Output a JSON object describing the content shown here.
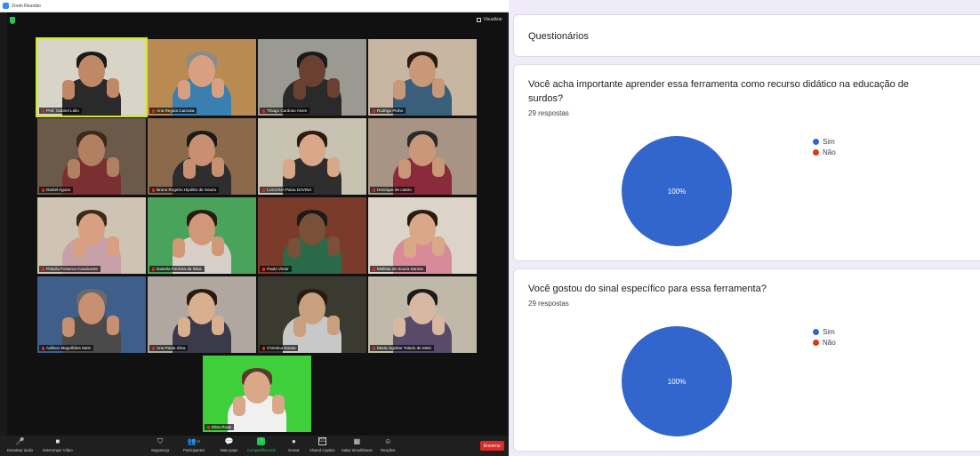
{
  "zoom": {
    "window_title": "Zoom Reunião",
    "view_label": "Visualizar",
    "participants": [
      {
        "name": "Prof. Gabriel Lúlio",
        "active": true
      },
      {
        "name": "Ana Regina Carcosa",
        "active": false
      },
      {
        "name": "Thiago Cardoso Alves",
        "active": false
      },
      {
        "name": "Rodrigo Pinho",
        "active": false
      },
      {
        "name": "Daniel Aguiar",
        "active": false
      },
      {
        "name": "Bruno Rogério Hipólito de Souza",
        "active": false
      },
      {
        "name": "LUCIANA Paiva DAVINA",
        "active": false
      },
      {
        "name": "Henrique de castro",
        "active": false
      },
      {
        "name": "Priscila Fonseca Cavalcante",
        "active": false
      },
      {
        "name": "Daniela Ferreira da Silva",
        "active": false
      },
      {
        "name": "Paulo Victor",
        "active": false
      },
      {
        "name": "Melissa de Souza Santos",
        "active": false
      },
      {
        "name": "Adilson Magalhães Melo",
        "active": false
      },
      {
        "name": "Ana Paula Silva",
        "active": false
      },
      {
        "name": "Christina Sousa",
        "active": false
      },
      {
        "name": "Maria Ogoline Toledo de Melo",
        "active": false
      },
      {
        "name": "Elisa Ruas",
        "active": false
      }
    ],
    "toolbar": {
      "audio": "Desativar áudio",
      "video": "Interromper Vídeo",
      "security": "Segurança",
      "participants": "Participantes",
      "participants_count": "17",
      "chat": "Bate-papo",
      "share": "Compartilhar tela",
      "record": "Gravar",
      "captions": "Closed Caption",
      "breakout": "Salas Simultâneas",
      "reactions": "Reações",
      "leave": "Encerrar"
    }
  },
  "forms": {
    "title": "Questionários",
    "questions": [
      {
        "text": "Você acha importante aprender essa ferramenta como recurso didático na educação de surdos?",
        "responses": "29 respostas"
      },
      {
        "text": "Você gostou do sinal específico para essa ferramenta?",
        "responses": "29 respostas"
      }
    ]
  },
  "chart_data": [
    {
      "type": "pie",
      "categories": [
        "Sim",
        "Não"
      ],
      "values": [
        100,
        0
      ],
      "labels": [
        "100%",
        ""
      ],
      "colors": [
        "#3366cc",
        "#dc3912"
      ],
      "legend": "right"
    },
    {
      "type": "pie",
      "categories": [
        "Sim",
        "Não"
      ],
      "values": [
        100,
        0
      ],
      "labels": [
        "100%",
        ""
      ],
      "colors": [
        "#3366cc",
        "#dc3912"
      ],
      "legend": "right"
    }
  ]
}
